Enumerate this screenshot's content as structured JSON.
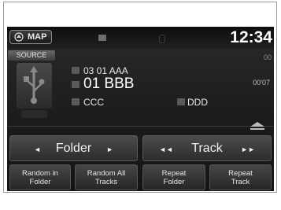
{
  "header": {
    "map_label": "MAP",
    "clock": "12:34"
  },
  "source": {
    "label": "SOURCE"
  },
  "now_playing": {
    "folder": "03 01 AAA",
    "track": "01 BBB",
    "album": "CCC",
    "artist": "DDD",
    "elapsed": "00'07",
    "remaining": "00"
  },
  "controls": {
    "folder_label": "Folder",
    "track_label": "Track",
    "prev_folder_icon": "left-arrow",
    "next_folder_icon": "right-arrow",
    "prev_track_icon": "skip-back",
    "next_track_icon": "skip-forward"
  },
  "modes": {
    "random_folder_l1": "Random in",
    "random_folder_l2": "Folder",
    "random_all_l1": "Random All",
    "random_all_l2": "Tracks",
    "repeat_folder_l1": "Repeat",
    "repeat_folder_l2": "Folder",
    "repeat_track_l1": "Repeat",
    "repeat_track_l2": "Track"
  }
}
